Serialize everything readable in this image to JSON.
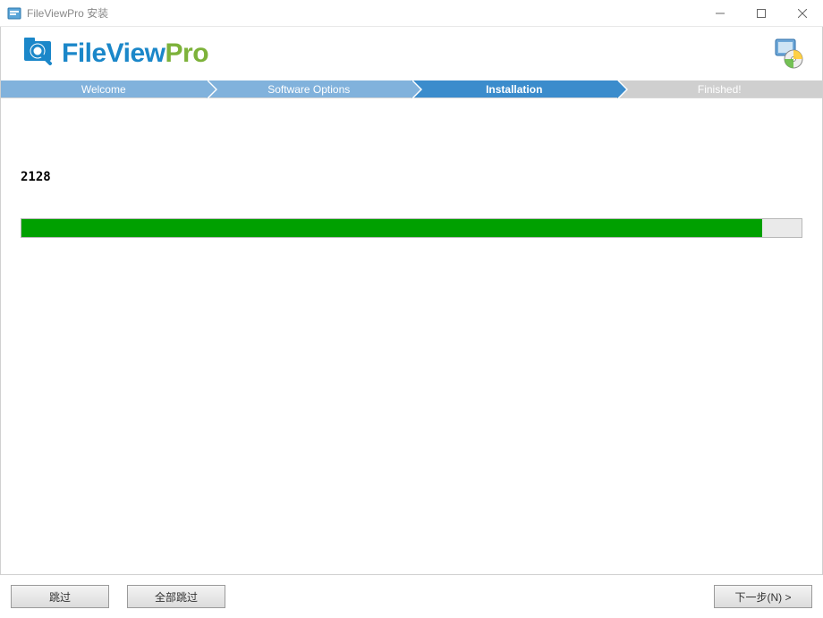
{
  "window": {
    "title": "FileViewPro 安装"
  },
  "logo": {
    "part1": "FileView",
    "part2": "Pro"
  },
  "steps": [
    {
      "label": "Welcome",
      "state": "done"
    },
    {
      "label": "Software Options",
      "state": "done"
    },
    {
      "label": "Installation",
      "state": "active"
    },
    {
      "label": "Finished!",
      "state": "future"
    }
  ],
  "progress": {
    "counter": "2128",
    "percent": 95
  },
  "buttons": {
    "skip": "跳过",
    "skip_all": "全部跳过",
    "next": "下一步(N) >"
  }
}
